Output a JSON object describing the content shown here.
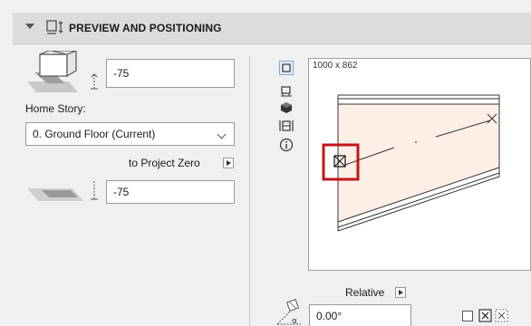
{
  "header": {
    "title": "PREVIEW AND POSITIONING"
  },
  "elevation": {
    "value": "-75"
  },
  "home_story": {
    "label": "Home Story:",
    "selected": "0. Ground Floor (Current)"
  },
  "project_zero": {
    "label": "to Project Zero",
    "value": "-75"
  },
  "preview": {
    "dimensions": "1000 x 862"
  },
  "rotation": {
    "reference_label": "Relative",
    "angle": "0.00°"
  },
  "colors": {
    "accent_red": "#c0161c",
    "preview_fill": "#fdeee6"
  }
}
